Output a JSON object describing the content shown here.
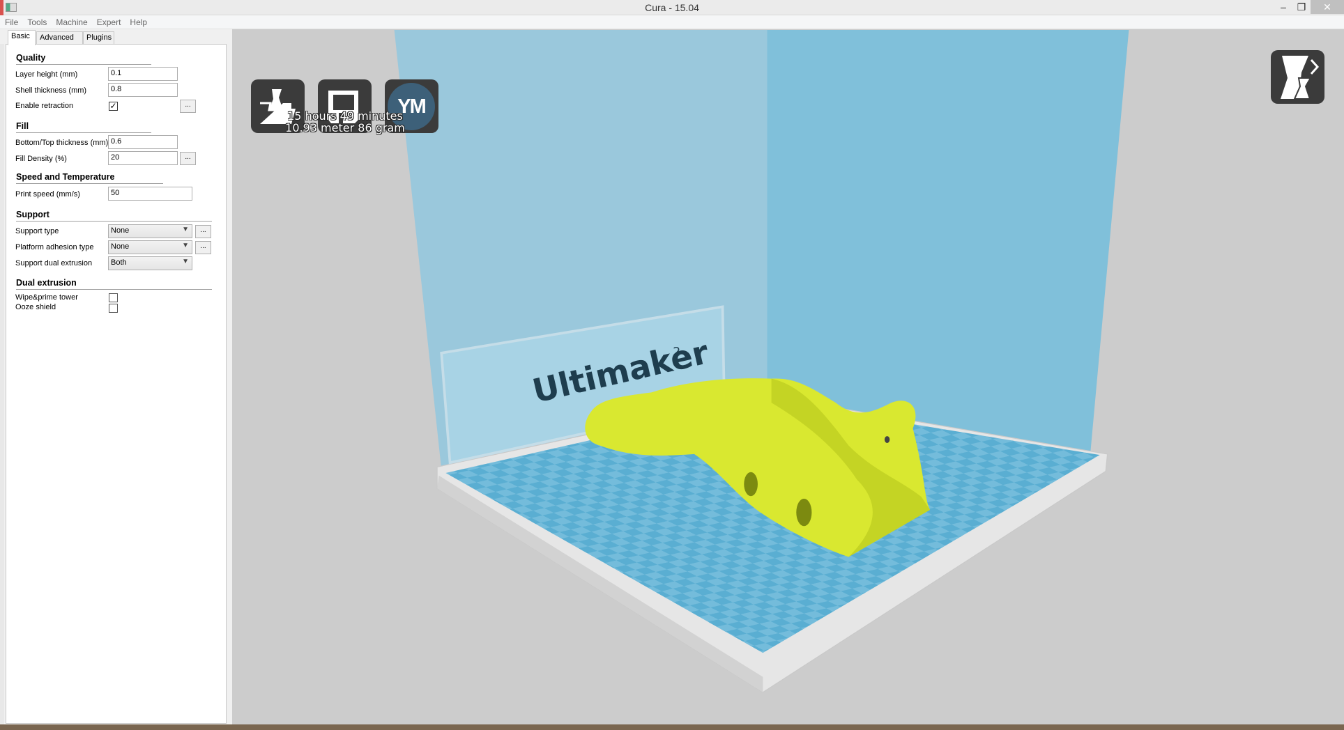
{
  "window": {
    "title": "Cura - 15.04",
    "minimize": "–",
    "restore": "❐",
    "close": "✕"
  },
  "menu": [
    "File",
    "Tools",
    "Machine",
    "Expert",
    "Help"
  ],
  "tabs": [
    {
      "label": "Basic",
      "active": true
    },
    {
      "label": "Advanced"
    },
    {
      "label": "Plugins"
    }
  ],
  "settings": {
    "quality": {
      "title": "Quality",
      "layer_height": {
        "label": "Layer height (mm)",
        "value": "0.1"
      },
      "shell_thickness": {
        "label": "Shell thickness (mm)",
        "value": "0.8"
      },
      "enable_retraction": {
        "label": "Enable retraction",
        "checked": true,
        "check": "✓",
        "more": "..."
      }
    },
    "fill": {
      "title": "Fill",
      "bottom_top": {
        "label": "Bottom/Top thickness (mm)",
        "value": "0.6"
      },
      "fill_density": {
        "label": "Fill Density (%)",
        "value": "20",
        "more": "..."
      }
    },
    "speed": {
      "title": "Speed and Temperature",
      "print_speed": {
        "label": "Print speed (mm/s)",
        "value": "50"
      }
    },
    "support": {
      "title": "Support",
      "support_type": {
        "label": "Support type",
        "value": "None",
        "more": "..."
      },
      "platform_adhesion": {
        "label": "Platform adhesion type",
        "value": "None",
        "more": "..."
      },
      "support_dual": {
        "label": "Support dual extrusion",
        "value": "Both"
      }
    },
    "dual": {
      "title": "Dual extrusion",
      "wipe_tower": {
        "label": "Wipe&prime tower",
        "checked": false
      },
      "ooze_shield": {
        "label": "Ooze shield",
        "checked": false
      }
    }
  },
  "viewport": {
    "toolbar": [
      {
        "icon": "load-model-icon"
      },
      {
        "icon": "save-gcode-icon"
      },
      {
        "icon": "youmagine-icon",
        "text": "YM"
      }
    ],
    "print_time": "15 hours 49 minutes",
    "print_material": "10.93 meter 86 gram",
    "view_mode_icon": "view-mode-icon",
    "machine_brand": "Ultimaker",
    "machine_model": "2",
    "colors": {
      "model": "#d9e830",
      "bed_blue": "#5aaed2",
      "wall_blue": "#7fc0da",
      "background": "#cccccc"
    }
  }
}
